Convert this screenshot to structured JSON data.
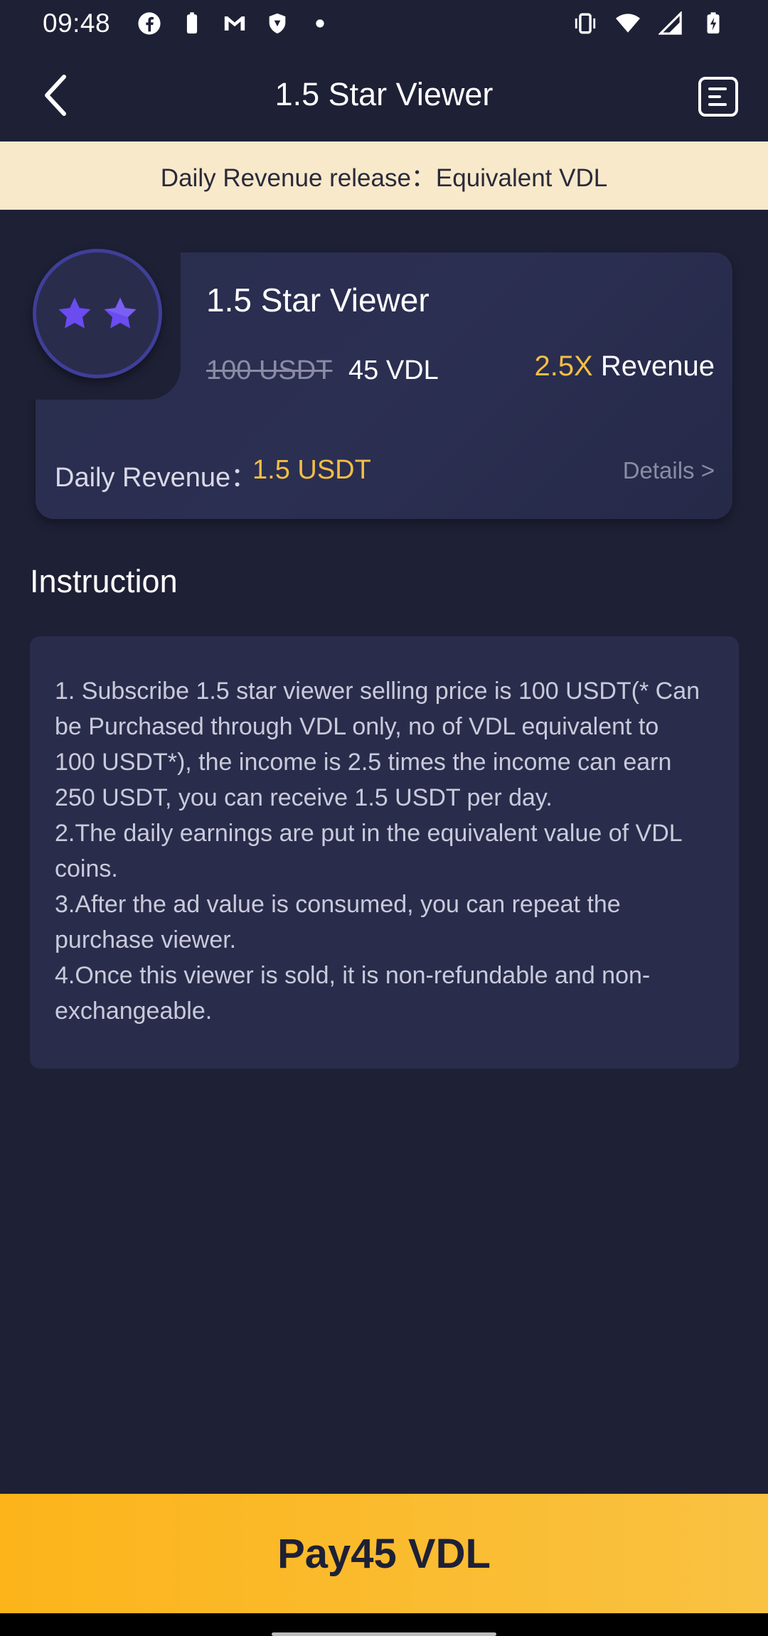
{
  "status_bar": {
    "time": "09:48",
    "icons_left": [
      "facebook-icon",
      "battery-icon",
      "gmail-icon",
      "shield-icon",
      "dot-icon"
    ],
    "icons_right": [
      "vibrate-icon",
      "wifi-icon",
      "signal-icon",
      "battery-charging-icon"
    ]
  },
  "header": {
    "title": "1.5 Star Viewer",
    "back_icon": "chevron-left-icon",
    "records_icon": "list-document-icon"
  },
  "notice": {
    "text": "Daily Revenue release：Equivalent VDL"
  },
  "product": {
    "title": "1.5 Star Viewer",
    "original_price": "100 USDT",
    "sale_price": "45 VDL",
    "multiplier": "2.5X",
    "revenue_label": "Revenue",
    "daily_revenue_label": "Daily Revenue：",
    "daily_revenue_value": "1.5 USDT",
    "details_link": "Details >",
    "badge_icon": "two-stars-icon",
    "colors": {
      "accent": "#f4be44",
      "star": "#6a4cf0"
    }
  },
  "instruction": {
    "heading": "Instruction",
    "lines": [
      "1. Subscribe 1.5 star viewer selling price is 100 USDT(* Can",
      "be Purchased through VDL only, no of VDL equivalent to",
      "100 USDT*), the income is 2.5 times the income can earn",
      "250 USDT, you can receive 1.5 USDT per day.",
      "2.The daily earnings are put in the equivalent value of VDL",
      "coins.",
      "3.After the ad value is consumed, you can repeat the",
      "purchase viewer.",
      "4.Once this viewer is sold, it is non-refundable and non-",
      "exchangeable."
    ]
  },
  "pay_button": {
    "label": "Pay45 VDL",
    "color": "#fcb41a"
  }
}
